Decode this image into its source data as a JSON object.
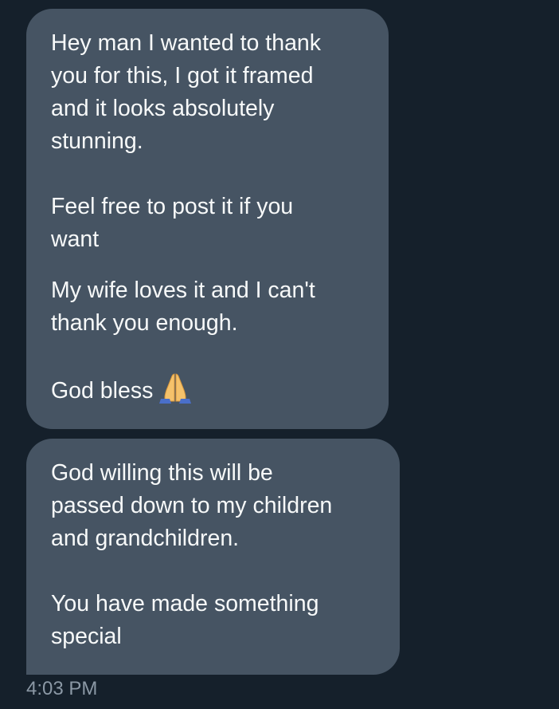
{
  "messages": [
    {
      "paragraphs": [
        "Hey man I wanted to thank\nyou for this, I got it framed\nand it looks absolutely\nstunning.",
        "Feel free to post it if you\nwant",
        "My wife loves it and I can't\nthank you enough.",
        "God bless"
      ],
      "trailing_emoji": "folded-hands-icon"
    },
    {
      "paragraphs": [
        "God willing this will be\npassed down to my children\nand grandchildren.",
        "You have made something\nspecial"
      ]
    }
  ],
  "timestamp": "4:03 PM",
  "colors": {
    "background": "#15202b",
    "bubble": "#465463",
    "text": "#f7f9f9",
    "timestamp": "#8b98a5"
  }
}
